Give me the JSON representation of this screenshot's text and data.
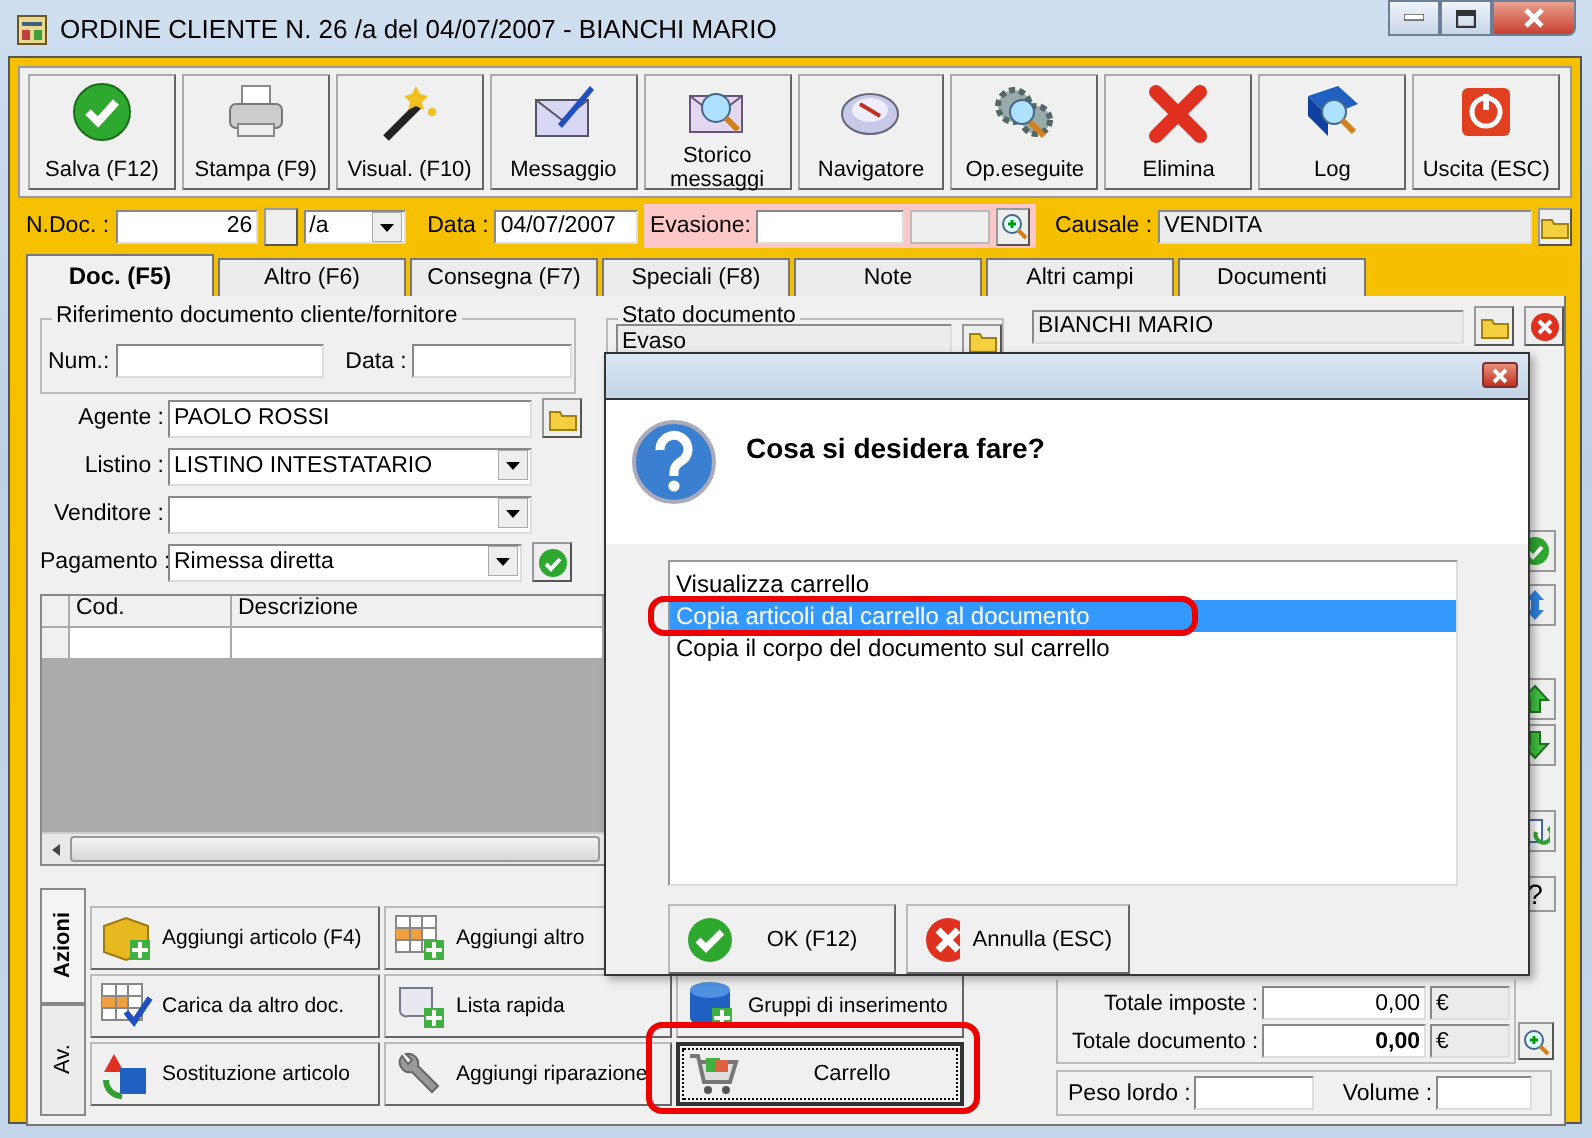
{
  "window": {
    "title": "ORDINE CLIENTE N. 26 /a del 04/07/2007 - BIANCHI MARIO"
  },
  "toolbar": [
    {
      "label": "Salva (F12)",
      "kind": "save"
    },
    {
      "label": "Stampa (F9)",
      "kind": "print"
    },
    {
      "label": "Visual. (F10)",
      "kind": "wand"
    },
    {
      "label": "Messaggio",
      "kind": "message"
    },
    {
      "label": "Storico messaggi",
      "kind": "history"
    },
    {
      "label": "Navigatore",
      "kind": "navigator"
    },
    {
      "label": "Op.eseguite",
      "kind": "operations"
    },
    {
      "label": "Elimina",
      "kind": "delete"
    },
    {
      "label": "Log",
      "kind": "log"
    },
    {
      "label": "Uscita (ESC)",
      "kind": "exit"
    }
  ],
  "header": {
    "ndoc_label": "N.Doc. :",
    "ndoc": "26",
    "series": "/a",
    "data_label": "Data :",
    "data": "04/07/2007",
    "evasione_label": "Evasione:",
    "causale_label": "Causale :",
    "causale": "VENDITA"
  },
  "tabs": [
    {
      "label": "Doc. (F5)",
      "selected": true
    },
    {
      "label": "Altro (F6)",
      "selected": false
    },
    {
      "label": "Consegna (F7)",
      "selected": false
    },
    {
      "label": "Speciali (F8)",
      "selected": false
    },
    {
      "label": "Note",
      "selected": false
    },
    {
      "label": "Altri campi",
      "selected": false
    },
    {
      "label": "Documenti",
      "selected": false
    }
  ],
  "reference": {
    "title": "Riferimento documento cliente/fornitore",
    "num_label": "Num.:",
    "data_label": "Data :"
  },
  "fields": [
    {
      "label": "Agente :",
      "value": "PAOLO ROSSI",
      "kind": "lookup"
    },
    {
      "label": "Listino :",
      "value": "LISTINO INTESTATARIO",
      "kind": "select"
    },
    {
      "label": "Venditore :",
      "kind": "select"
    },
    {
      "label": "Pagamento :",
      "value": "Rimessa diretta",
      "kind": "confirm"
    }
  ],
  "status": {
    "title": "Stato documento",
    "value": "Evaso"
  },
  "customer": {
    "name": "BIANCHI MARIO"
  },
  "grid": {
    "columns": [
      "Cod.",
      "Descrizione"
    ]
  },
  "side_buttons": [
    {
      "kind": "confirm"
    },
    {
      "kind": "updown"
    },
    {
      "kind": "up"
    },
    {
      "kind": "down"
    },
    {
      "kind": "refresh"
    },
    {
      "kind": "help",
      "label": "?"
    }
  ],
  "side_tabs": [
    {
      "label": "Azioni",
      "selected": true
    },
    {
      "label": "Av.",
      "selected": false
    }
  ],
  "actions": [
    {
      "label": "Aggiungi articolo (F4)",
      "kind": "box",
      "annotated": false
    },
    {
      "label": "Aggiungi altro",
      "kind": "grid_add",
      "annotated": false
    },
    {
      "label": "Carica da altro doc.",
      "kind": "grid_check",
      "annotated": false
    },
    {
      "label": "Lista rapida",
      "kind": "scroll",
      "annotated": false
    },
    {
      "label": "Gruppi di inserimento",
      "kind": "db",
      "annotated": false
    },
    {
      "label": "Sostituzione articolo",
      "kind": "swap",
      "annotated": false
    },
    {
      "label": "Aggiungi riparazione",
      "kind": "wrench",
      "annotated": false
    },
    {
      "label": "Carrello",
      "kind": "cart",
      "annotated": true
    }
  ],
  "totals": [
    {
      "label": "Totale imposte :",
      "value": "0,00",
      "currency": "€",
      "emphasized": false
    },
    {
      "label": "Totale documento :",
      "value": "0,00",
      "currency": "€",
      "emphasized": true
    }
  ],
  "weights": {
    "peso_label": "Peso lordo :",
    "volume_label": "Volume :"
  },
  "dialog": {
    "question": "Cosa si desidera fare?",
    "options": [
      {
        "label": "Visualizza carrello",
        "selected": false,
        "annotated": false
      },
      {
        "label": "Copia articoli dal carrello al documento",
        "selected": true,
        "annotated": true
      },
      {
        "label": "Copia il corpo del documento sul carrello",
        "selected": false,
        "annotated": false
      }
    ],
    "buttons": [
      {
        "label": "OK (F12)",
        "kind": "ok"
      },
      {
        "label": "Annulla (ESC)",
        "kind": "cancel"
      }
    ]
  }
}
